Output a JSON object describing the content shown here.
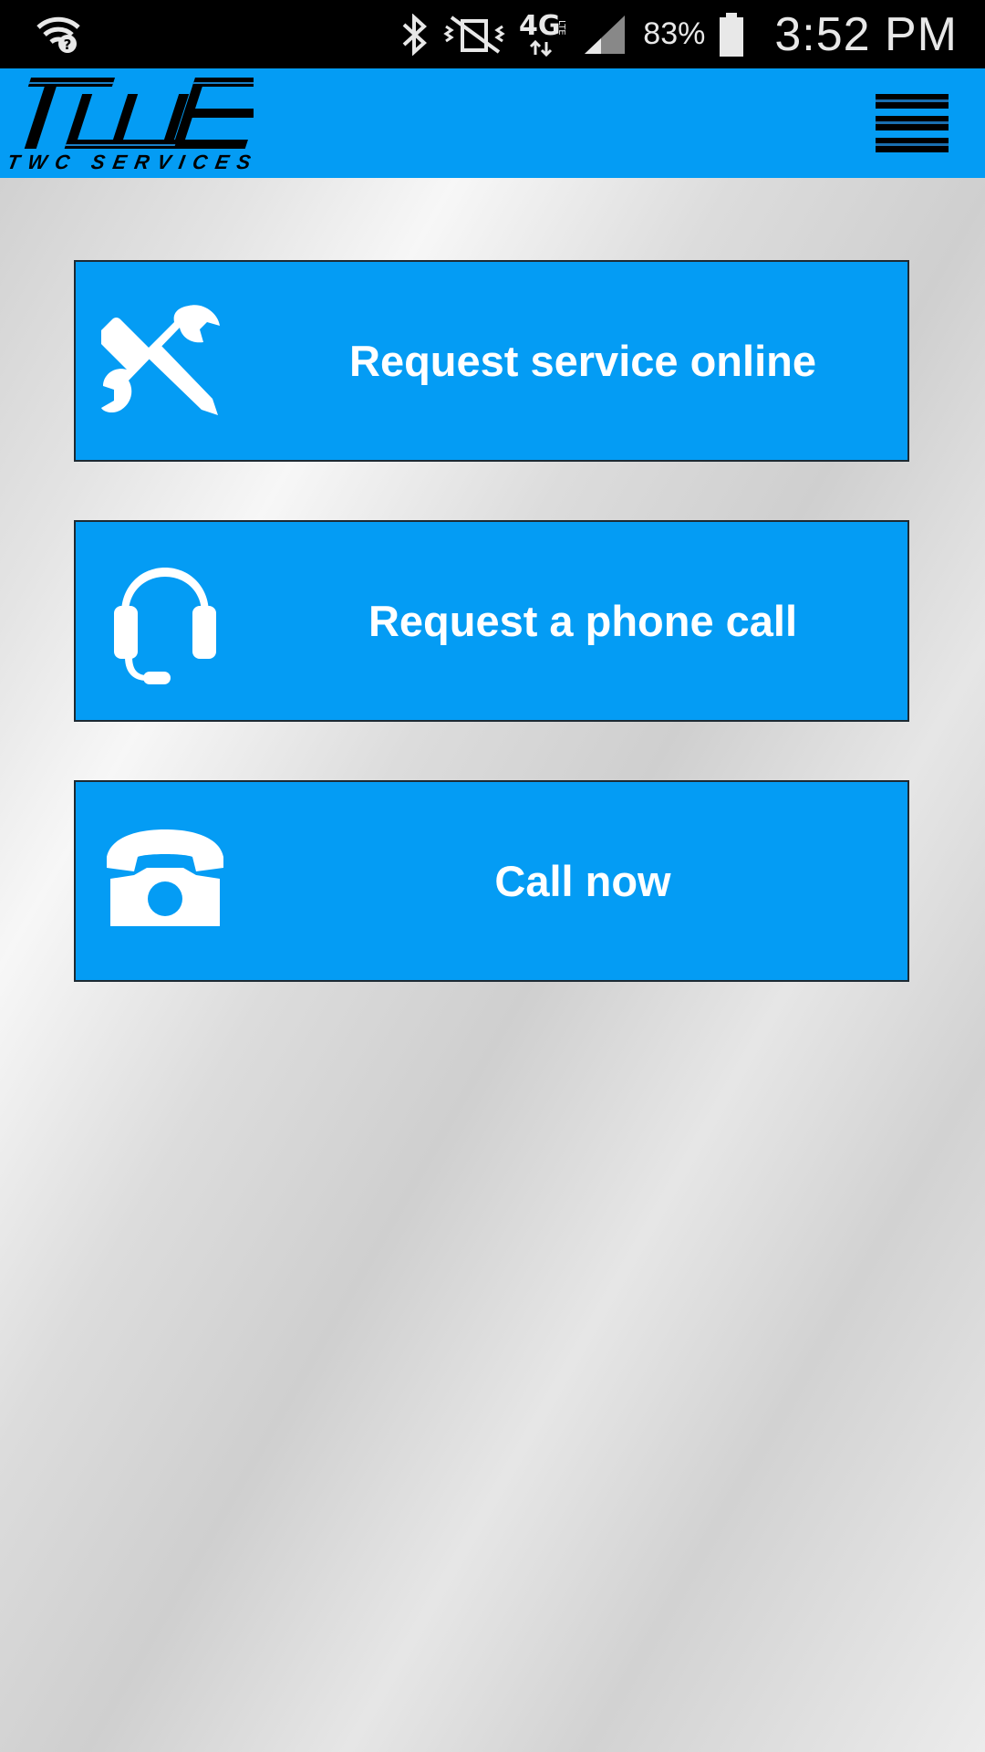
{
  "status_bar": {
    "battery_percent": "83%",
    "time": "3:52 PM",
    "network": "4G LTE",
    "icons": [
      "wifi-icon",
      "bluetooth-icon",
      "vibrate-mute-icon",
      "lte-icon",
      "signal-icon",
      "battery-icon"
    ]
  },
  "header": {
    "logo_text": "TWC SERVICES",
    "logo_icon": "twc-logo",
    "menu_icon": "hamburger-menu-icon",
    "background_color": "#049cf4"
  },
  "actions": [
    {
      "label": "Request service online",
      "icon": "tools-icon"
    },
    {
      "label": "Request a phone call",
      "icon": "headset-icon"
    },
    {
      "label": "Call now",
      "icon": "telephone-icon"
    }
  ],
  "colors": {
    "accent": "#049cf4",
    "button_text": "#ffffff",
    "status_bar": "#000000"
  }
}
